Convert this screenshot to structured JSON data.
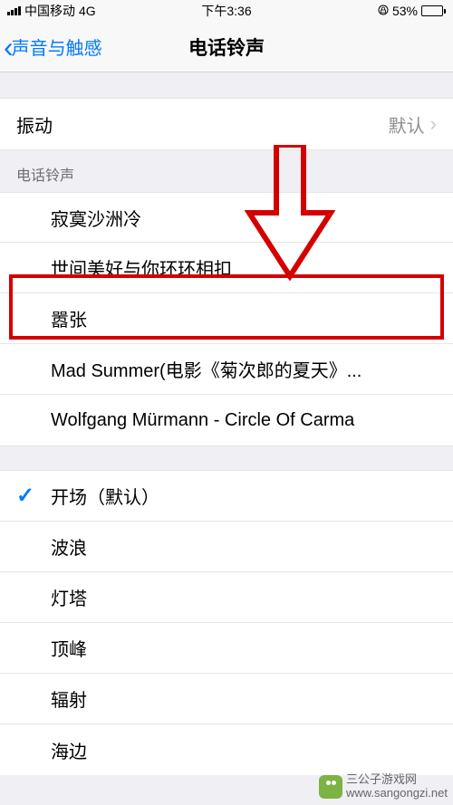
{
  "status": {
    "carrier": "中国移动",
    "network": "4G",
    "time": "下午3:36",
    "battery_percent": "53%"
  },
  "nav": {
    "back_label": "声音与触感",
    "title": "电话铃声"
  },
  "vibration": {
    "label": "振动",
    "value": "默认"
  },
  "section_header": "电话铃声",
  "custom_ringtones": [
    "寂寞沙洲冷",
    "世间美好与你环环相扣",
    "嚣张",
    "Mad Summer(电影《菊次郎的夏天》...",
    "Wolfgang Mürmann - Circle Of Carma"
  ],
  "system_ringtones": [
    "开场（默认）",
    "波浪",
    "灯塔",
    "顶峰",
    "辐射",
    "海边"
  ],
  "selected_index": 0,
  "watermark": {
    "line1": "三公子游戏网",
    "line2": "www.sangongzi.net"
  }
}
